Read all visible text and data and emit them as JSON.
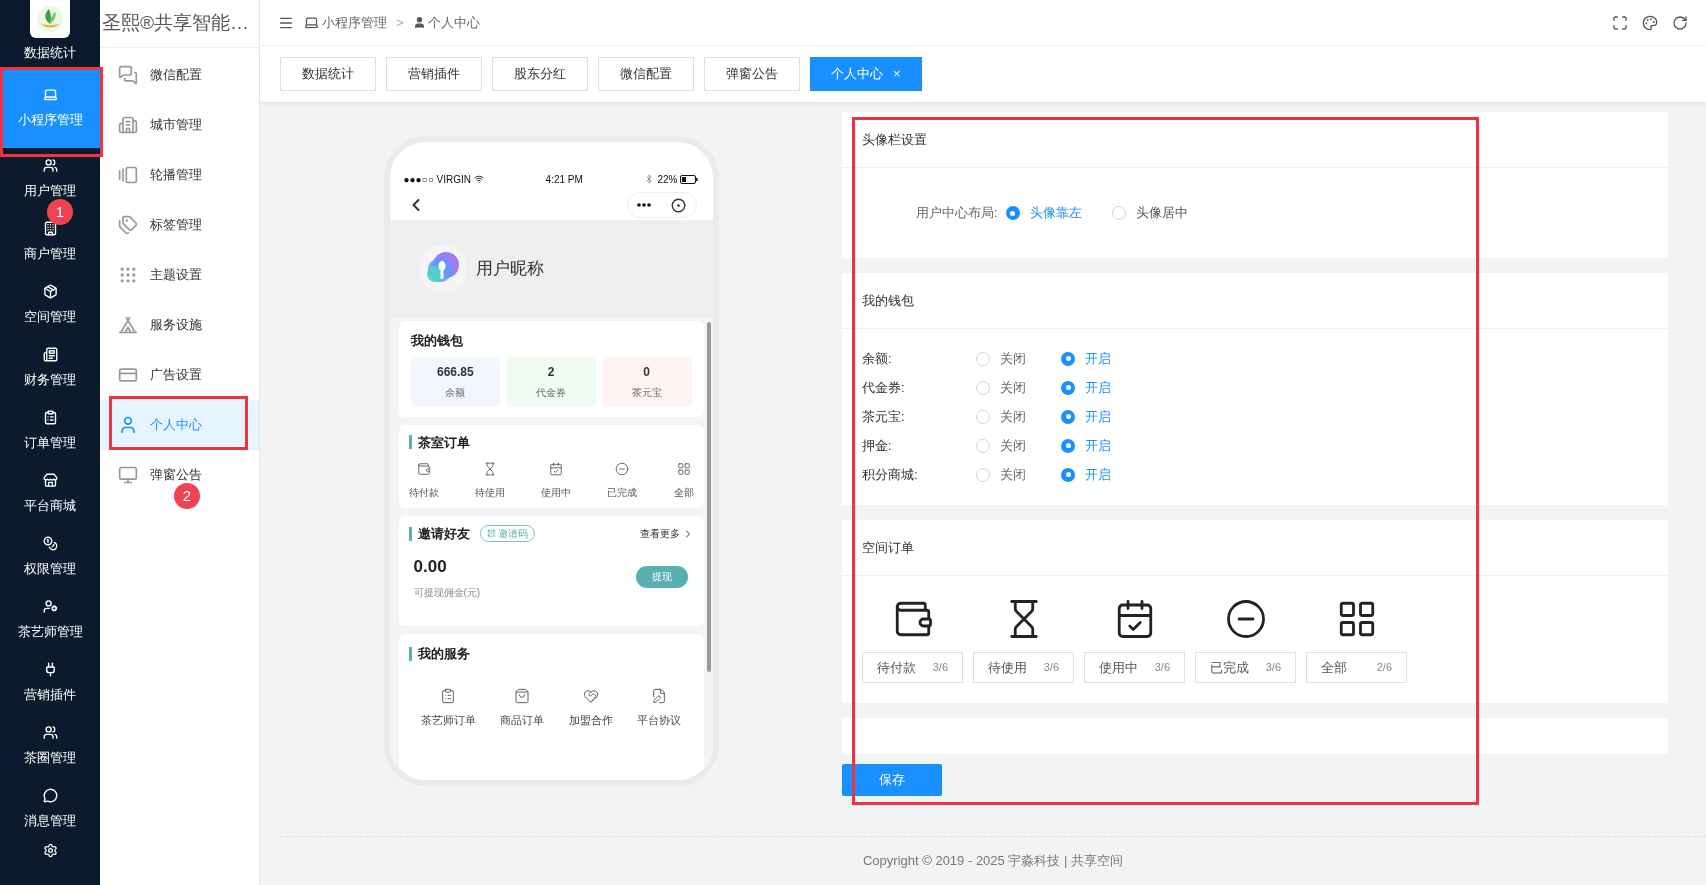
{
  "main_nav": {
    "items": [
      {
        "label": "数据统计",
        "selected": false
      },
      {
        "label": "小程序管理",
        "selected": true
      },
      {
        "label": "用户管理",
        "selected": false
      },
      {
        "label": "商户管理",
        "selected": false
      },
      {
        "label": "空间管理",
        "selected": false
      },
      {
        "label": "财务管理",
        "selected": false
      },
      {
        "label": "订单管理",
        "selected": false
      },
      {
        "label": "平台商城",
        "selected": false
      },
      {
        "label": "权限管理",
        "selected": false
      },
      {
        "label": "茶艺师管理",
        "selected": false
      },
      {
        "label": "营销插件",
        "selected": false
      },
      {
        "label": "茶圈管理",
        "selected": false
      },
      {
        "label": "消息管理",
        "selected": false
      }
    ]
  },
  "sub_nav": {
    "title": "圣熙®共享智能…",
    "items": [
      {
        "label": "微信配置",
        "selected": false
      },
      {
        "label": "城市管理",
        "selected": false
      },
      {
        "label": "轮播管理",
        "selected": false
      },
      {
        "label": "标签管理",
        "selected": false
      },
      {
        "label": "主题设置",
        "selected": false
      },
      {
        "label": "服务设施",
        "selected": false
      },
      {
        "label": "广告设置",
        "selected": false
      },
      {
        "label": "个人中心",
        "selected": true
      },
      {
        "label": "弹窗公告",
        "selected": false
      }
    ]
  },
  "breadcrumb": {
    "parent": "小程序管理",
    "separator": ">",
    "current": "个人中心"
  },
  "tabs": [
    {
      "label": "数据统计",
      "selected": false
    },
    {
      "label": "营销插件",
      "selected": false
    },
    {
      "label": "股东分红",
      "selected": false
    },
    {
      "label": "微信配置",
      "selected": false
    },
    {
      "label": "弹窗公告",
      "selected": false
    },
    {
      "label": "个人中心",
      "selected": true,
      "close": "×"
    }
  ],
  "phone": {
    "status_bar": {
      "carrier": "●●●○○ VIRGIN",
      "time": "4:21 PM",
      "battery": "22%"
    },
    "nickname": "用户昵称",
    "wallet": {
      "title": "我的钱包",
      "items": [
        {
          "value": "666.85",
          "label": "余额",
          "color": "#f3f6ff"
        },
        {
          "value": "2",
          "label": "代金券",
          "color": "#effbf3"
        },
        {
          "value": "0",
          "label": "茶元宝",
          "color": "#fff4f3"
        }
      ]
    },
    "room_orders": {
      "title": "茶室订单",
      "items": [
        "待付款",
        "待使用",
        "使用中",
        "已完成",
        "全部"
      ]
    },
    "invite": {
      "title": "邀请好友",
      "badge": "邀请码",
      "more": "查看更多",
      "amount": "0.00",
      "caption": "可提现佣金(元)",
      "button": "提现"
    },
    "services": {
      "title": "我的服务",
      "items": [
        "茶艺师订单",
        "商品订单",
        "加盟合作",
        "平台协议"
      ]
    }
  },
  "settings": {
    "sections": [
      {
        "kind": "layout",
        "title": "头像栏设置",
        "label": "用户中心布局:",
        "options": [
          {
            "label": "头像靠左",
            "selected": true
          },
          {
            "label": "头像居中",
            "selected": false
          }
        ]
      },
      {
        "kind": "toggles",
        "title": "我的钱包",
        "rows": [
          {
            "label": "余额:",
            "options": [
              {
                "label": "关闭",
                "selected": false
              },
              {
                "label": "开启",
                "selected": true
              }
            ]
          },
          {
            "label": "代金券:",
            "options": [
              {
                "label": "关闭",
                "selected": false
              },
              {
                "label": "开启",
                "selected": true
              }
            ]
          },
          {
            "label": "茶元宝:",
            "options": [
              {
                "label": "关闭",
                "selected": false
              },
              {
                "label": "开启",
                "selected": true
              }
            ]
          },
          {
            "label": "押金:",
            "options": [
              {
                "label": "关闭",
                "selected": false
              },
              {
                "label": "开启",
                "selected": true
              }
            ]
          },
          {
            "label": "积分商城:",
            "options": [
              {
                "label": "关闭",
                "selected": false
              },
              {
                "label": "开启",
                "selected": true
              }
            ]
          }
        ]
      },
      {
        "kind": "orders",
        "title": "空间订单",
        "items": [
          {
            "label": "待付款",
            "count": "3/6"
          },
          {
            "label": "待使用",
            "count": "3/6"
          },
          {
            "label": "使用中",
            "count": "3/6"
          },
          {
            "label": "已完成",
            "count": "3/6"
          },
          {
            "label": "全部",
            "count": "2/6"
          }
        ]
      },
      {
        "kind": "empty"
      }
    ],
    "save_button": "保存"
  },
  "markers": [
    {
      "label": "1"
    },
    {
      "label": "2"
    }
  ],
  "footer": "Copyright © 2019 - 2025 宇淼科技 | 共享空间"
}
